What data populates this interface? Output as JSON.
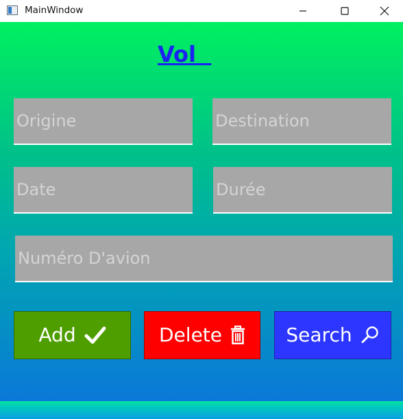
{
  "window": {
    "title": "MainWindow",
    "controls": [
      "minimize",
      "maximize",
      "close"
    ]
  },
  "page": {
    "title": "Vol  "
  },
  "fields": {
    "origine": {
      "placeholder": "Origine",
      "value": ""
    },
    "destination": {
      "placeholder": "Destination",
      "value": ""
    },
    "date": {
      "placeholder": "Date",
      "value": ""
    },
    "duree": {
      "placeholder": "Durée",
      "value": ""
    },
    "numero_avion": {
      "placeholder": "Numéro D'avion",
      "value": ""
    }
  },
  "buttons": {
    "add": {
      "label": "Add",
      "icon": "checkmark-icon",
      "color": "#4e9e00"
    },
    "delete": {
      "label": "Delete",
      "icon": "trash-icon",
      "color": "#ff0000"
    },
    "search": {
      "label": "Search",
      "icon": "search-icon",
      "color": "#2d36ff"
    }
  },
  "colors": {
    "gradient_top": "#00f060",
    "gradient_bottom": "#0a78d8",
    "field_background": "#a7a7a7",
    "title_color": "#1a23f0"
  }
}
